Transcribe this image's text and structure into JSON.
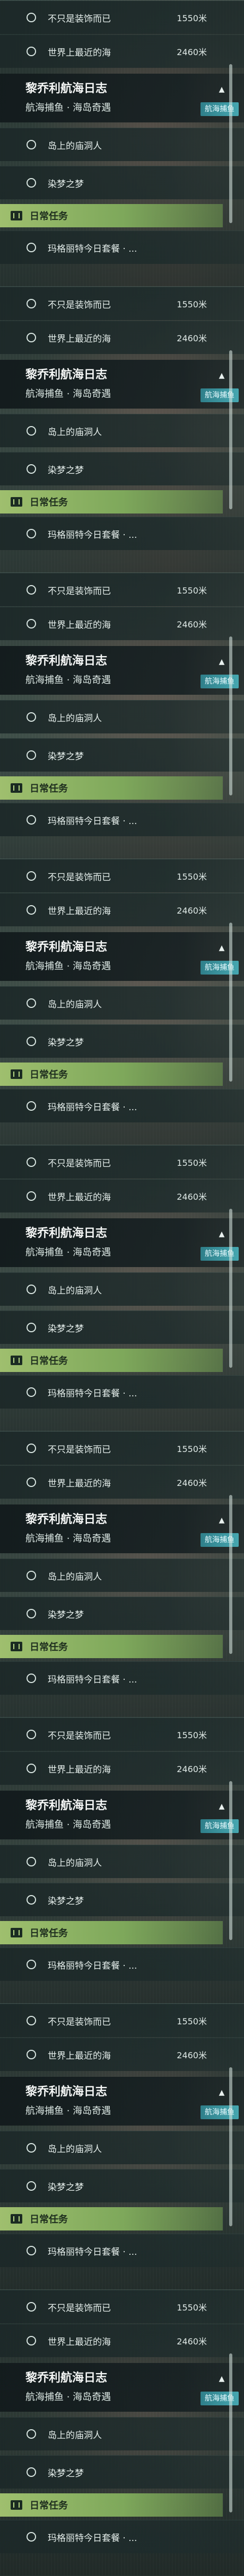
{
  "quests": {
    "row1_label": "不只是装饰而已",
    "row1_distance": "1550米",
    "row2_label": "世界上最近的海",
    "row2_distance": "2460米",
    "header_title": "黎乔利航海日志",
    "header_subtitle": "航海捕鱼 · 海岛奇遇",
    "header_chip": "航海捕鱼",
    "row3_label": "岛上的庙洞人",
    "row4_label": "染梦之梦",
    "daily_label": "日常任务",
    "row5_label": "玛格丽特今日套餐 · ..."
  },
  "colors": {
    "accent_green": "#9fbf6e",
    "chip_teal": "#46a7b0"
  },
  "icons": {
    "circle": "quest-circle-icon",
    "caret": "chevron-up-icon",
    "task": "daily-task-icon"
  }
}
